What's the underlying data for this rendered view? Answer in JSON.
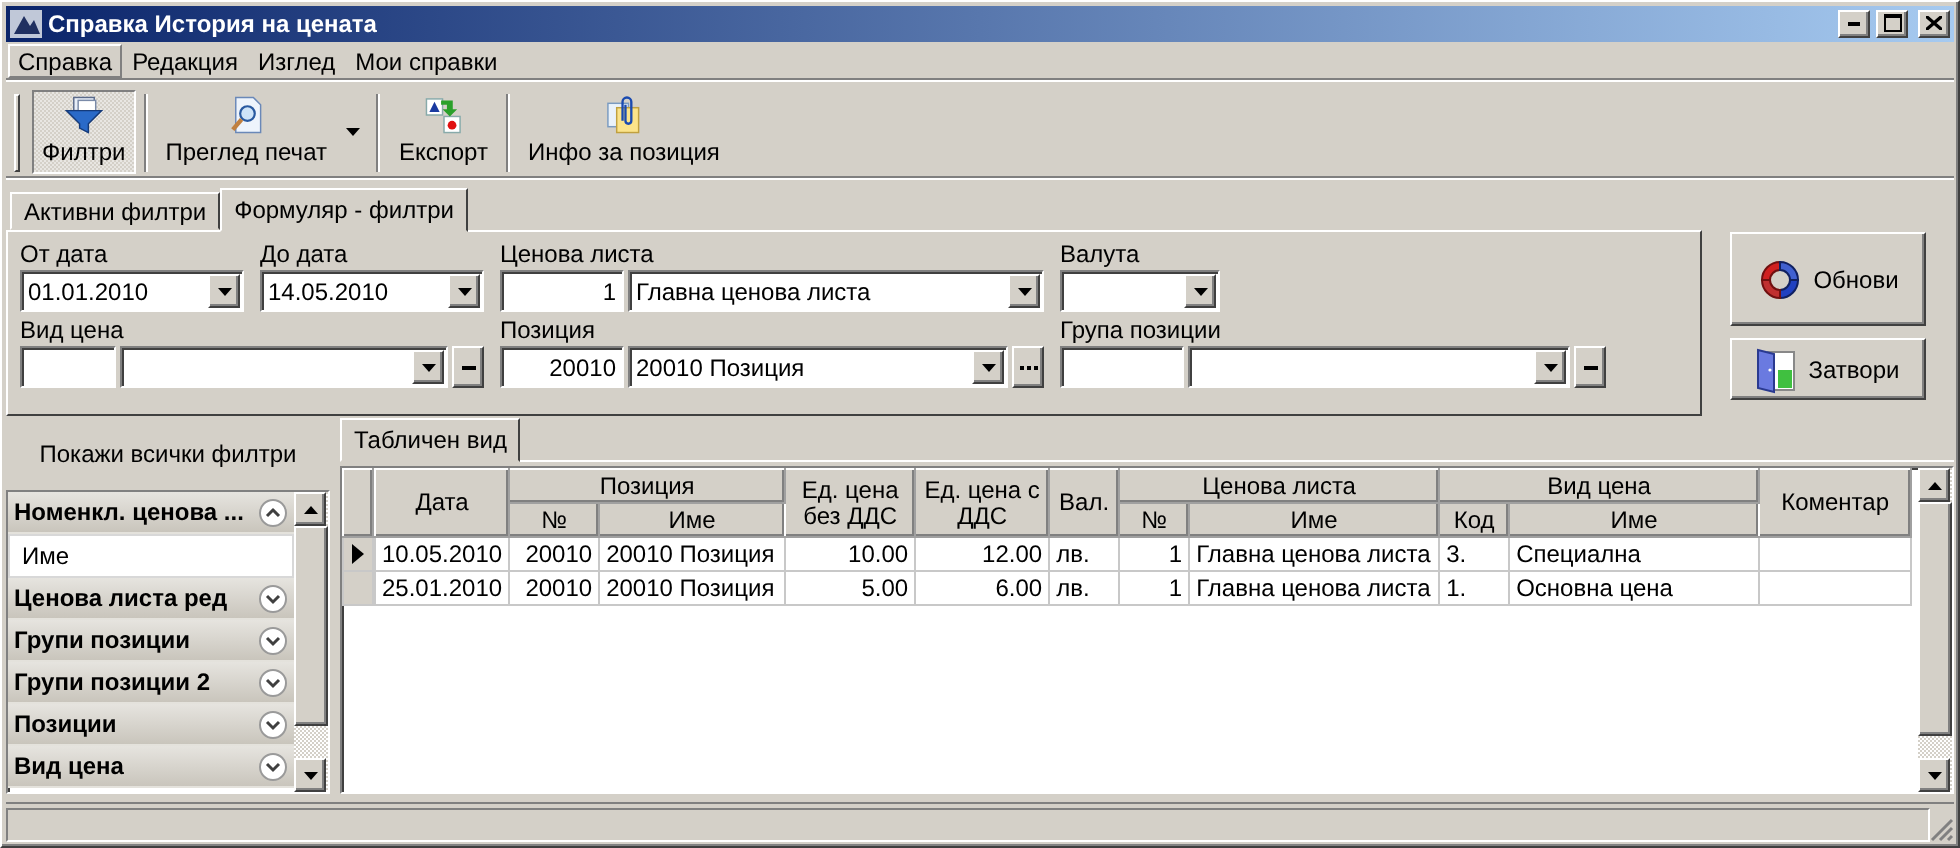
{
  "window": {
    "title": "Справка История на цената"
  },
  "menu": [
    {
      "label": "Справка",
      "selected": true
    },
    {
      "label": "Редакция",
      "selected": false
    },
    {
      "label": "Изглед",
      "selected": false
    },
    {
      "label": "Мои справки",
      "selected": false
    }
  ],
  "toolbar": [
    {
      "label": "Филтри",
      "kind": "filter",
      "pressed": true,
      "dropdown": false
    },
    {
      "label": "Преглед печат",
      "kind": "preview",
      "pressed": false,
      "dropdown": true
    },
    {
      "label": "Експорт",
      "kind": "export",
      "pressed": false,
      "dropdown": false
    },
    {
      "label": "Инфо за позиция",
      "kind": "info",
      "pressed": false,
      "dropdown": false
    }
  ],
  "tabs": [
    {
      "label": "Активни филтри",
      "selected": false
    },
    {
      "label": "Формуляр - филтри",
      "selected": true
    }
  ],
  "filters": {
    "from_date": {
      "label": "От дата",
      "value": "01.01.2010"
    },
    "to_date": {
      "label": "До дата",
      "value": "14.05.2010"
    },
    "price_list": {
      "label": "Ценова листа",
      "code": "1",
      "value": "Главна ценова листа"
    },
    "currency": {
      "label": "Валута"
    },
    "price_type": {
      "label": "Вид цена"
    },
    "position": {
      "label": "Позиция",
      "code": "20010",
      "value": "20010 Позиция"
    },
    "position_group": {
      "label": "Група позиции"
    }
  },
  "actions": [
    {
      "label": "Обнови",
      "kind": "refresh"
    },
    {
      "label": "Затвори",
      "kind": "close"
    }
  ],
  "side_panel": {
    "show_all": "Покажи всички филтри",
    "groups": [
      {
        "title": "Номенкл. ценова ...",
        "expanded": true,
        "children": [
          {
            "label": "Име"
          }
        ]
      },
      {
        "title": "Ценова листа ред",
        "expanded": false
      },
      {
        "title": "Групи позиции",
        "expanded": false
      },
      {
        "title": "Групи позиции 2",
        "expanded": false
      },
      {
        "title": "Позиции",
        "expanded": false
      },
      {
        "title": "Вид цена",
        "expanded": false
      }
    ]
  },
  "view_tabs": [
    {
      "label": "Табличен вид",
      "selected": true
    }
  ],
  "table": {
    "columns": [
      {
        "label": "Дата"
      },
      {
        "label": "Позиция",
        "colspan": 2,
        "children": [
          {
            "label": "№"
          },
          {
            "label": "Име"
          }
        ]
      },
      {
        "label": "Ед. цена без ДДС"
      },
      {
        "label": "Ед. цена с ДДС"
      },
      {
        "label": "Вал."
      },
      {
        "label": "Ценова листа",
        "colspan": 2,
        "children": [
          {
            "label": "№"
          },
          {
            "label": "Име"
          }
        ]
      },
      {
        "label": "Вид цена",
        "colspan": 2,
        "children": [
          {
            "label": "Код"
          },
          {
            "label": "Име"
          }
        ]
      },
      {
        "label": "Коментар"
      }
    ],
    "rows": [
      {
        "current": true,
        "cells": [
          "10.05.2010",
          "20010",
          "20010 Позиция",
          "10.00",
          "12.00",
          "лв.",
          "1",
          "Главна ценова листа",
          "3.",
          "Специална",
          ""
        ]
      },
      {
        "current": false,
        "cells": [
          "25.01.2010",
          "20010",
          "20010 Позиция",
          "5.00",
          "6.00",
          "лв.",
          "1",
          "Главна ценова листа",
          "1.",
          "Основна цена",
          ""
        ]
      }
    ]
  }
}
